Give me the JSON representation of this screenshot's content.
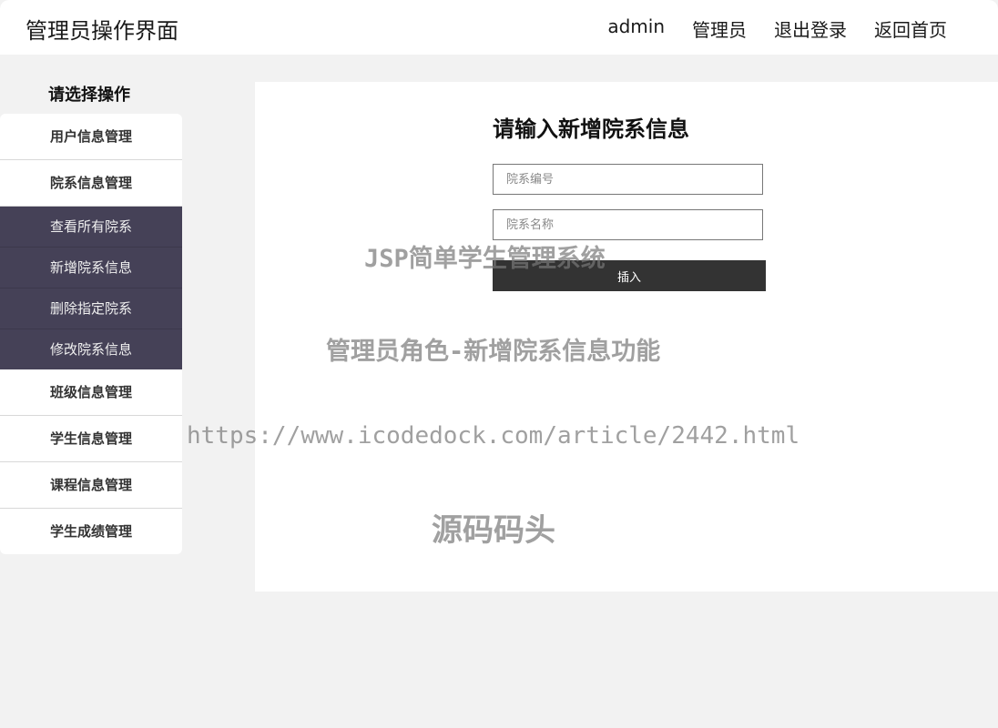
{
  "header": {
    "title": "管理员操作界面",
    "nav": {
      "user": "admin",
      "role": "管理员",
      "logout": "退出登录",
      "home": "返回首页"
    }
  },
  "sidebar": {
    "heading": "请选择操作",
    "items": [
      "用户信息管理",
      "院系信息管理",
      "班级信息管理",
      "学生信息管理",
      "课程信息管理",
      "学生成绩管理"
    ],
    "submenu": [
      "查看所有院系",
      "新增院系信息",
      "删除指定院系",
      "修改院系信息"
    ]
  },
  "form": {
    "title": "请输入新增院系信息",
    "dept_id_placeholder": "院系编号",
    "dept_name_placeholder": "院系名称",
    "submit_label": "插入"
  },
  "watermarks": {
    "line1": "JSP简单学生管理系统",
    "line2": "管理员角色-新增院系信息功能",
    "line3": "https://www.icodedock.com/article/2442.html",
    "line4": "源码码头"
  }
}
